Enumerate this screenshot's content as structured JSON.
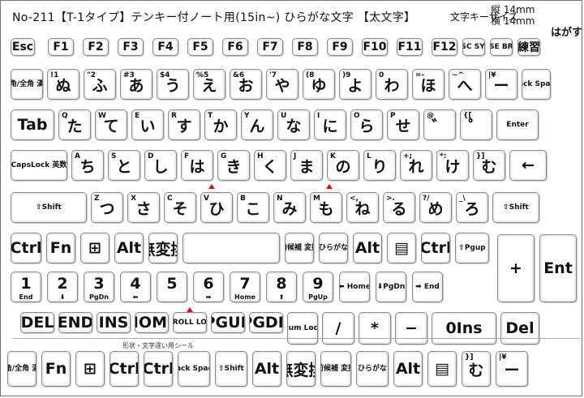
{
  "header": {
    "title": "No-211【T-1タイプ】テンキー付ノート用(15in~) ひらがな文字 【太文字】",
    "spec_label": "文字キーサイズ",
    "spec_h": "縦 14mm",
    "spec_w": "横 14mm",
    "peel": "はがす"
  },
  "rows": {
    "fn": [
      {
        "main": "Esc",
        "name": "key-esc"
      },
      {
        "main": "F1",
        "name": "key-f1"
      },
      {
        "main": "F2",
        "name": "key-f2"
      },
      {
        "main": "F3",
        "name": "key-f3"
      },
      {
        "main": "F4",
        "name": "key-f4"
      },
      {
        "main": "F5",
        "name": "key-f5"
      },
      {
        "main": "F6",
        "name": "key-f6"
      },
      {
        "main": "F7",
        "name": "key-f7"
      },
      {
        "main": "F8",
        "name": "key-f8"
      },
      {
        "main": "F9",
        "name": "key-f9"
      },
      {
        "main": "F10",
        "name": "key-f10"
      },
      {
        "main": "F11",
        "name": "key-f11"
      },
      {
        "main": "F12",
        "name": "key-f12"
      },
      {
        "main": "PRTSC SYSRQ",
        "name": "key-prtsc"
      },
      {
        "main": "PAUSE BREAK",
        "name": "key-pause"
      },
      {
        "main": "練習",
        "name": "key-practice"
      }
    ],
    "num": [
      {
        "main": "半角/全角 漢字",
        "name": "key-hankaku"
      },
      {
        "main": "ぬ",
        "sub": "!1",
        "name": "key-1"
      },
      {
        "main": "ふ",
        "sub": "\"2",
        "name": "key-2"
      },
      {
        "main": "あ",
        "sub": "#3",
        "name": "key-3"
      },
      {
        "main": "う",
        "sub": "$4",
        "name": "key-4"
      },
      {
        "main": "え",
        "sub": "%5",
        "name": "key-5"
      },
      {
        "main": "お",
        "sub": "&6",
        "name": "key-6"
      },
      {
        "main": "や",
        "sub": "'7",
        "name": "key-7"
      },
      {
        "main": "ゆ",
        "sub": "(8",
        "name": "key-8"
      },
      {
        "main": "よ",
        "sub": ")9",
        "name": "key-9"
      },
      {
        "main": "わ",
        "sub": "0",
        "name": "key-0"
      },
      {
        "main": "ほ",
        "sub": "=-",
        "name": "key-minus"
      },
      {
        "main": "へ",
        "sub": "~^",
        "name": "key-caret"
      },
      {
        "main": "ー",
        "sub": "|¥",
        "name": "key-yen"
      },
      {
        "main": "Back Space",
        "name": "key-backspace"
      }
    ],
    "q": [
      {
        "main": "Tab",
        "name": "key-tab"
      },
      {
        "main": "た",
        "sub": "Q",
        "name": "key-q"
      },
      {
        "main": "て",
        "sub": "W",
        "name": "key-w"
      },
      {
        "main": "い",
        "sub": "E",
        "name": "key-e"
      },
      {
        "main": "す",
        "sub": "R",
        "name": "key-r"
      },
      {
        "main": "か",
        "sub": "T",
        "name": "key-t"
      },
      {
        "main": "ん",
        "sub": "Y",
        "name": "key-y"
      },
      {
        "main": "な",
        "sub": "U",
        "name": "key-u"
      },
      {
        "main": "に",
        "sub": "I",
        "name": "key-i"
      },
      {
        "main": "ら",
        "sub": "O",
        "name": "key-o"
      },
      {
        "main": "せ",
        "sub": "P",
        "name": "key-p"
      },
      {
        "main": "゛",
        "sub": "@",
        "name": "key-at"
      },
      {
        "main": "゜",
        "sub": "{[",
        "name": "key-bracket"
      },
      {
        "main": "Enter",
        "name": "key-enter"
      }
    ],
    "a": [
      {
        "main": "CapsLock 英数",
        "name": "key-capslock"
      },
      {
        "main": "ち",
        "sub": "A",
        "name": "key-a"
      },
      {
        "main": "と",
        "sub": "S",
        "name": "key-s"
      },
      {
        "main": "し",
        "sub": "D",
        "name": "key-d"
      },
      {
        "main": "は",
        "sub": "F",
        "name": "key-f"
      },
      {
        "main": "き",
        "sub": "G",
        "name": "key-g"
      },
      {
        "main": "く",
        "sub": "H",
        "name": "key-h"
      },
      {
        "main": "ま",
        "sub": "J",
        "name": "key-j"
      },
      {
        "main": "の",
        "sub": "K",
        "name": "key-k"
      },
      {
        "main": "り",
        "sub": "L",
        "name": "key-l"
      },
      {
        "main": "れ",
        "sub": "+;",
        "name": "key-semicolon"
      },
      {
        "main": "け",
        "sub": "*:",
        "name": "key-colon"
      },
      {
        "main": "む",
        "sub": "}]",
        "name": "key-closebracket"
      },
      {
        "main": "←",
        "name": "key-enter-tail"
      }
    ],
    "z": [
      {
        "main": "⇧Shift",
        "name": "key-lshift"
      },
      {
        "main": "つ",
        "sub": "Z",
        "name": "key-z"
      },
      {
        "main": "さ",
        "sub": "X",
        "name": "key-x"
      },
      {
        "main": "そ",
        "sub": "C",
        "name": "key-c"
      },
      {
        "main": "ひ",
        "sub": "V",
        "name": "key-v"
      },
      {
        "main": "こ",
        "sub": "B",
        "name": "key-b"
      },
      {
        "main": "み",
        "sub": "N",
        "name": "key-n"
      },
      {
        "main": "も",
        "sub": "M",
        "name": "key-m"
      },
      {
        "main": "ね",
        "sub": "<,",
        "name": "key-comma"
      },
      {
        "main": "る",
        "sub": ">.",
        "name": "key-period"
      },
      {
        "main": "め",
        "sub": "?/",
        "name": "key-slash"
      },
      {
        "main": "ろ",
        "sub": "_\\",
        "name": "key-backslash"
      },
      {
        "main": "⇧Shift",
        "name": "key-rshift"
      }
    ],
    "ctrl": [
      {
        "main": "Ctrl",
        "name": "key-lctrl"
      },
      {
        "main": "Fn",
        "name": "key-fn"
      },
      {
        "main": "⊞",
        "name": "key-win"
      },
      {
        "main": "Alt",
        "name": "key-lalt"
      },
      {
        "main": "無変換",
        "name": "key-muhenkan"
      },
      {
        "main": "",
        "name": "key-space"
      },
      {
        "main": "前候補 変換",
        "name": "key-henkan"
      },
      {
        "main": "カタカナ ひらがな ローマ字",
        "name": "key-kana"
      },
      {
        "main": "Alt",
        "name": "key-ralt"
      },
      {
        "main": "▤",
        "name": "key-menu"
      },
      {
        "main": "Ctrl",
        "name": "key-rctrl"
      },
      {
        "main": "⇧Pgup",
        "name": "key-pgup-arrow"
      }
    ],
    "numrow": [
      {
        "main": "1",
        "sub2": "End",
        "name": "key-np1"
      },
      {
        "main": "2",
        "sub2": "⬇",
        "name": "key-np2"
      },
      {
        "main": "3",
        "sub2": "PgDn",
        "name": "key-np3"
      },
      {
        "main": "4",
        "sub2": "⬅",
        "name": "key-np4"
      },
      {
        "main": "5",
        "sub2": "",
        "name": "key-np5"
      },
      {
        "main": "6",
        "sub2": "➡",
        "name": "key-np6"
      },
      {
        "main": "7",
        "sub2": "Home",
        "name": "key-np7"
      },
      {
        "main": "8",
        "sub2": "⬆",
        "name": "key-np8"
      },
      {
        "main": "9",
        "sub2": "PgUp",
        "name": "key-np9"
      },
      {
        "main": "⬅ Home",
        "name": "key-home-arrow"
      },
      {
        "main": "⬇PgDn",
        "name": "key-pgdn-arrow"
      },
      {
        "main": "➡ End",
        "name": "key-end-arrow"
      }
    ],
    "edit": [
      {
        "main": "DEL",
        "name": "key-del"
      },
      {
        "main": "END",
        "name": "key-end"
      },
      {
        "main": "INS",
        "name": "key-ins"
      },
      {
        "main": "HOME",
        "name": "key-home"
      },
      {
        "main": "SCROLL LOCK",
        "name": "key-scrolllock"
      },
      {
        "main": "PGUP",
        "name": "key-pgup"
      },
      {
        "main": "PGDN",
        "name": "key-pgdn"
      },
      {
        "main": "Num Lock",
        "name": "key-numlock"
      },
      {
        "main": "/",
        "name": "key-np-divide"
      },
      {
        "main": "*",
        "name": "key-np-multiply"
      },
      {
        "main": "−",
        "name": "key-np-minus"
      },
      {
        "main": "0Ins",
        "name": "key-np0"
      },
      {
        "main": "Del",
        "name": "key-np-del"
      }
    ],
    "bottom": [
      {
        "main": "半角/全角 漢字",
        "name": "key-b-hankaku"
      },
      {
        "main": "Fn",
        "name": "key-b-fn"
      },
      {
        "main": "⊞",
        "name": "key-b-win"
      },
      {
        "main": "Ctrl",
        "name": "key-b-ctrl1"
      },
      {
        "main": "Ctrl",
        "name": "key-b-ctrl2"
      },
      {
        "main": "Back Space",
        "name": "key-b-backspace"
      },
      {
        "main": "⇧Shift",
        "name": "key-b-shift"
      },
      {
        "main": "Alt",
        "name": "key-b-alt1"
      },
      {
        "main": "無変換",
        "name": "key-b-muhenkan"
      },
      {
        "main": "前候補 変換",
        "name": "key-b-henkan"
      },
      {
        "main": "カタカナ ひらがな ローマ字",
        "name": "key-b-kana"
      },
      {
        "main": "Alt",
        "name": "key-b-alt2"
      },
      {
        "main": "▤",
        "name": "key-b-menu"
      },
      {
        "main": "む",
        "sub": "}]",
        "name": "key-b-closebracket"
      },
      {
        "main": "ー",
        "sub": "|¥",
        "name": "key-b-yen"
      }
    ],
    "np_plus": {
      "main": "+",
      "name": "key-np-plus"
    },
    "np_ent": {
      "main": "Ent",
      "name": "key-np-enter"
    }
  },
  "note": "形状・文字違い用シール"
}
